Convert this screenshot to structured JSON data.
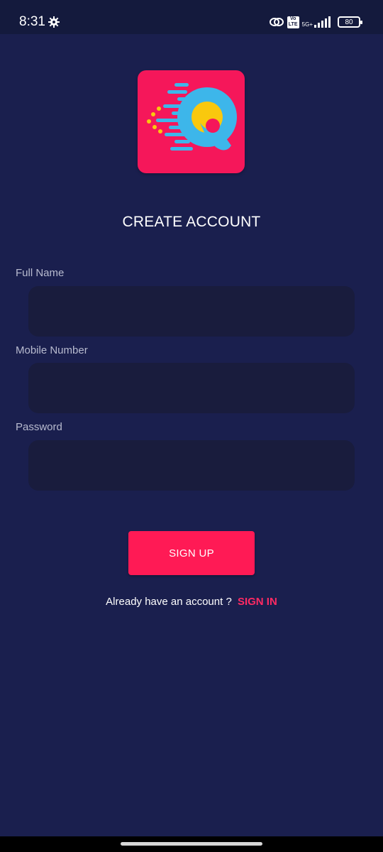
{
  "status_bar": {
    "time": "8:31",
    "network_badge_top": "Vo",
    "network_badge_bottom": "LTE",
    "network_type": "5G+",
    "battery": "80"
  },
  "logo": {
    "icon": "app-logo-q",
    "background_color": "#f5175a"
  },
  "form": {
    "title": "CREATE ACCOUNT",
    "fields": [
      {
        "label": "Full Name",
        "value": "",
        "placeholder": ""
      },
      {
        "label": "Mobile Number",
        "value": "",
        "placeholder": ""
      },
      {
        "label": "Password",
        "value": "",
        "placeholder": ""
      }
    ],
    "submit_label": "SIGN UP"
  },
  "footer": {
    "prompt": "Already have an account ?",
    "link_label": "SIGN IN"
  },
  "colors": {
    "background": "#1a1f4e",
    "accent": "#ff1a55",
    "input_background": "#191c3d"
  }
}
